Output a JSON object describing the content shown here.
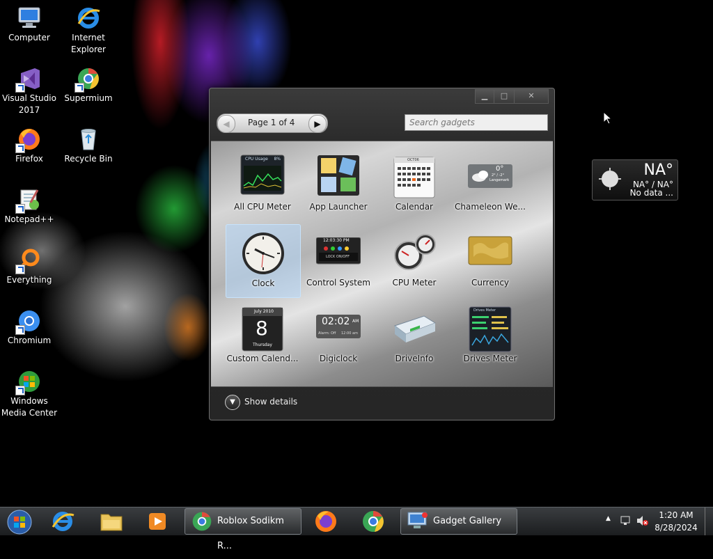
{
  "desktop": {
    "icons": [
      {
        "label": "Computer",
        "icon": "computer-icon"
      },
      {
        "label": "Internet\nExplorer",
        "icon": "internet-explorer-icon"
      },
      {
        "label": "Visual Studio\n2017",
        "icon": "visual-studio-icon"
      },
      {
        "label": "Supermium",
        "icon": "supermium-icon"
      },
      {
        "label": "Firefox",
        "icon": "firefox-icon"
      },
      {
        "label": "Recycle Bin",
        "icon": "recycle-bin-icon"
      },
      {
        "label": "Notepad++",
        "icon": "notepad-plus-plus-icon"
      },
      {
        "label": "Everything",
        "icon": "everything-search-icon"
      },
      {
        "label": "Chromium",
        "icon": "chromium-icon"
      },
      {
        "label": "Windows\nMedia Center",
        "icon": "windows-media-center-icon"
      }
    ]
  },
  "gallery": {
    "pager_text": "Page 1 of 4",
    "search_placeholder": "Search gadgets",
    "show_details": "Show details",
    "gadgets": [
      {
        "name": "All CPU Meter",
        "icon": "all-cpu-meter-icon",
        "selected": false
      },
      {
        "name": "App Launcher",
        "icon": "app-launcher-icon",
        "selected": false
      },
      {
        "name": "Calendar",
        "icon": "calendar-icon",
        "selected": false
      },
      {
        "name": "Chameleon We...",
        "icon": "chameleon-weather-icon",
        "selected": false
      },
      {
        "name": "Clock",
        "icon": "clock-icon",
        "selected": true
      },
      {
        "name": "Control System",
        "icon": "control-system-icon",
        "selected": false
      },
      {
        "name": "CPU Meter",
        "icon": "cpu-meter-icon",
        "selected": false
      },
      {
        "name": "Currency",
        "icon": "currency-icon",
        "selected": false
      },
      {
        "name": "Custom Calend...",
        "icon": "custom-calendar-icon",
        "selected": false
      },
      {
        "name": "Digiclock",
        "icon": "digiclock-icon",
        "selected": false
      },
      {
        "name": "DriveInfo",
        "icon": "driveinfo-icon",
        "selected": false
      },
      {
        "name": "Drives Meter",
        "icon": "drives-meter-icon",
        "selected": false
      }
    ],
    "thumb_text": {
      "cpu_usage": "CPU Usage",
      "cpu_pct": "8%",
      "cal_month": "OCT06",
      "cham_temp": "0°",
      "cham_range": "2° / -2°",
      "cham_place": "Langemark",
      "ctrl_time": "12:03:30 PM",
      "ctrl_lock": "LOCK ON/OFF",
      "custom_month": "July 2010",
      "custom_day": "8",
      "custom_weekday": "Thursday",
      "digi_time": "02:02",
      "digi_am": "AM",
      "digi_alarm": "Alarm: Off",
      "digi_alarm_time": "12:00 am",
      "drives_title": "Drives Meter"
    }
  },
  "weather": {
    "temp": "NA°",
    "range": "NA° / NA°",
    "status": "No data ..."
  },
  "taskbar": {
    "tasks": [
      {
        "label": "Roblox Sodikm R...",
        "icon": "supermium-icon"
      },
      {
        "label": "Gadget Gallery",
        "icon": "gadget-gallery-icon"
      }
    ],
    "time": "1:20 AM",
    "date": "8/28/2024"
  }
}
